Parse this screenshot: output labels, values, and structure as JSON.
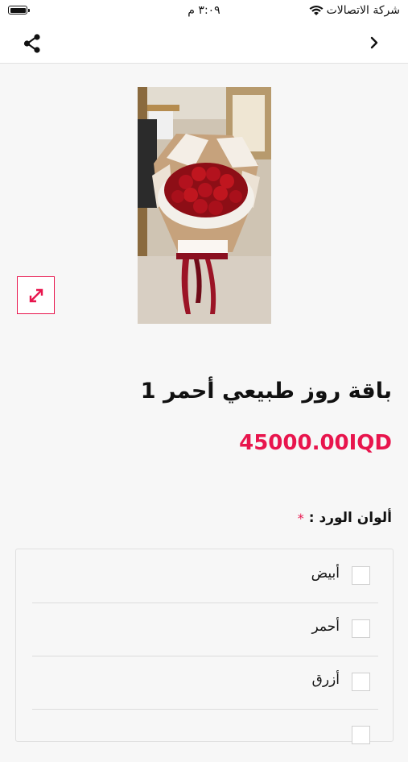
{
  "status_bar": {
    "carrier": "شركة الاتصالات",
    "time": "٣:٠٩ م",
    "battery_level": 1.0
  },
  "navbar": {
    "share_icon": "share-icon",
    "back_icon": "chevron-right-icon"
  },
  "product": {
    "image_alt": "red-rose-bouquet-photo",
    "expand_icon": "expand-icon",
    "title": "باقة روز طبيعي أحمر 1",
    "price": "45000.00IQD"
  },
  "options": {
    "label": "ألوان الورد :",
    "required_marker": "*",
    "items": [
      {
        "label": "أبيض",
        "checked": false
      },
      {
        "label": "أحمر",
        "checked": false
      },
      {
        "label": "أزرق",
        "checked": false
      }
    ]
  },
  "colors": {
    "accent": "#e8154d",
    "background": "#f7f7f7"
  }
}
